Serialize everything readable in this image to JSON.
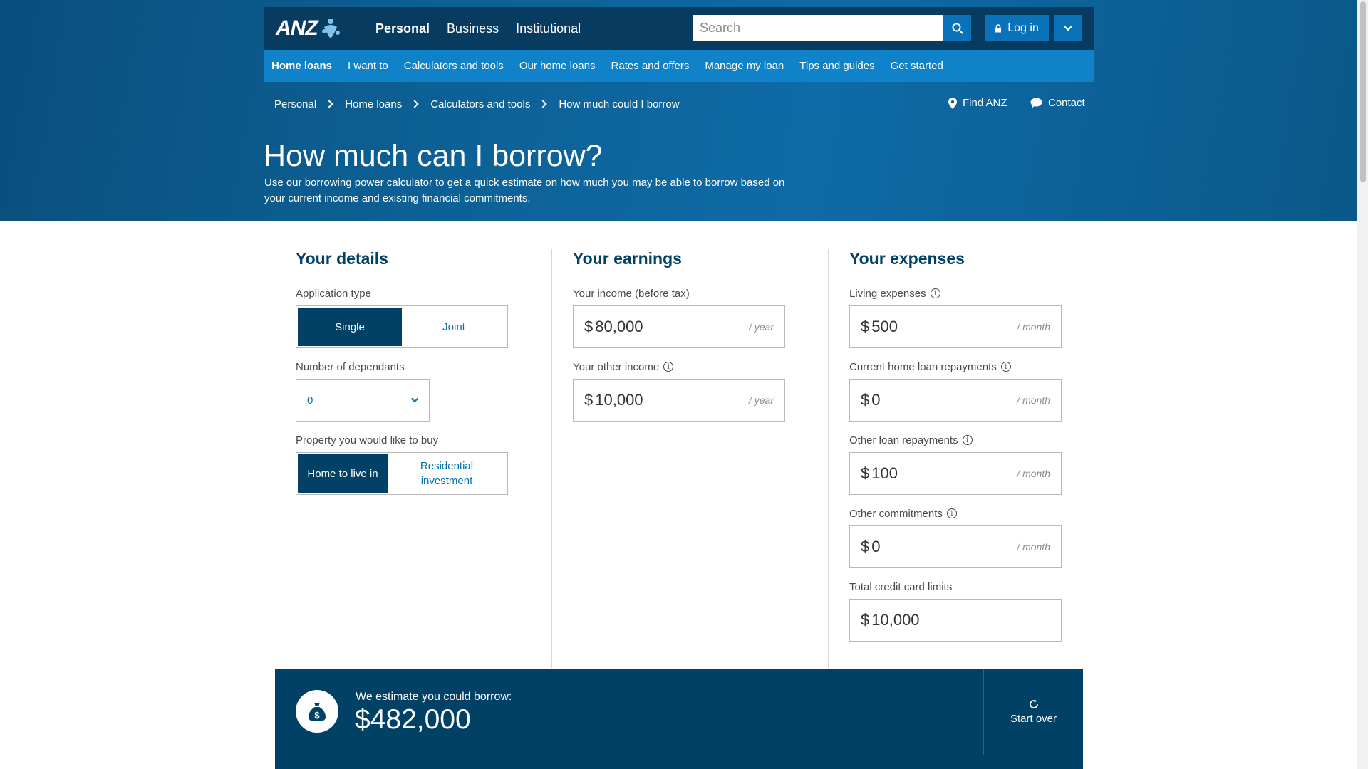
{
  "colors": {
    "brand_dark": "#073b60",
    "brand_blue": "#0f82c9",
    "selected": "#004165",
    "link": "#0072ac"
  },
  "header": {
    "logo_text": "ANZ",
    "segments": [
      {
        "label": "Personal",
        "active": true
      },
      {
        "label": "Business",
        "active": false
      },
      {
        "label": "Institutional",
        "active": false
      }
    ],
    "search_placeholder": "Search",
    "login_label": "Log in"
  },
  "subnav": {
    "items": [
      {
        "label": "Home loans"
      },
      {
        "label": "I want to"
      },
      {
        "label": "Calculators and tools"
      },
      {
        "label": "Our home loans"
      },
      {
        "label": "Rates and offers"
      },
      {
        "label": "Manage my loan"
      },
      {
        "label": "Tips and guides"
      },
      {
        "label": "Get started"
      }
    ]
  },
  "breadcrumb": {
    "items": [
      "Personal",
      "Home loans",
      "Calculators and tools",
      "How much could I borrow"
    ]
  },
  "utility": {
    "find": "Find ANZ",
    "contact": "Contact"
  },
  "page": {
    "title": "How much can I borrow?",
    "intro": "Use our borrowing power calculator to get a quick estimate on how much you may be able to borrow based on your current income and existing financial commitments."
  },
  "details": {
    "title": "Your details",
    "application_type": {
      "label": "Application type",
      "options": [
        "Single",
        "Joint"
      ],
      "selected": "Single"
    },
    "dependants": {
      "label": "Number of dependants",
      "value": "0"
    },
    "property": {
      "label": "Property you would like to buy",
      "options": [
        "Home to live in",
        "Residential investment"
      ],
      "selected": "Home to live in"
    }
  },
  "earnings": {
    "title": "Your earnings",
    "income": {
      "label": "Your income (before tax)",
      "currency": "$",
      "value": "80,000",
      "period": "/ year"
    },
    "other_income": {
      "label": "Your other income",
      "currency": "$",
      "value": "10,000",
      "period": "/ year"
    }
  },
  "expenses": {
    "title": "Your expenses",
    "living": {
      "label": "Living expenses",
      "currency": "$",
      "value": "500",
      "period": "/ month"
    },
    "home_loan": {
      "label": "Current home loan repayments",
      "currency": "$",
      "value": "0",
      "period": "/ month"
    },
    "other_loan": {
      "label": "Other loan repayments",
      "currency": "$",
      "value": "100",
      "period": "/ month"
    },
    "commitments": {
      "label": "Other commitments",
      "currency": "$",
      "value": "0",
      "period": "/ month"
    },
    "credit_limits": {
      "label": "Total credit card limits",
      "currency": "$",
      "value": "10,000"
    }
  },
  "result": {
    "label": "We estimate you could borrow:",
    "value": "$482,000",
    "start_over": "Start over"
  }
}
